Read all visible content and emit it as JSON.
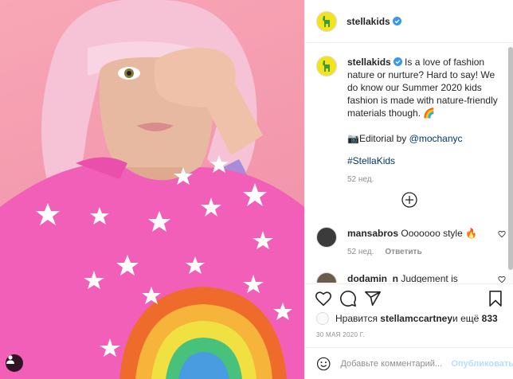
{
  "header": {
    "username": "stellakids"
  },
  "caption": {
    "username": "stellakids",
    "text": "Is a love of fashion nature or nurture? Hard to say! We do know our Summer 2020 kids fashion is made with nature-friendly materials though. 🌈",
    "credit_prefix": "📷Editorial by ",
    "credit_handle": "@mochanyc",
    "hashtag": "#StellaKids",
    "time": "52 нед."
  },
  "comments": [
    {
      "username": "mansabros",
      "text": "Ooooooo style 🔥",
      "time": "52 нед.",
      "reply": "Ответить"
    },
    {
      "username": "dodamin_n",
      "text": "Judgement is"
    }
  ],
  "likes": {
    "prefix": "Нравится ",
    "user": "stellamccartney",
    "middle": " и ещё ",
    "count": "833"
  },
  "date": "30 МАЯ 2020 Г.",
  "composer": {
    "placeholder": "Добавьте комментарий...",
    "publish": "Опубликовать"
  },
  "colors": {
    "brand_avatar": "#f4e21e",
    "verified": "#3897f0",
    "link": "#00376b",
    "publish_disabled": "#b2dffc"
  },
  "icons": [
    "heart-icon",
    "comment-icon",
    "share-icon",
    "bookmark-icon",
    "add-comments-icon",
    "emoji-icon",
    "user-tag-icon",
    "verified-badge-icon"
  ]
}
